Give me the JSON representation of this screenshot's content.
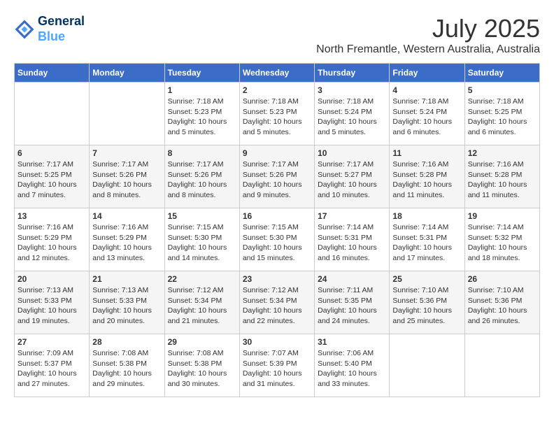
{
  "header": {
    "logo_line1": "General",
    "logo_line2": "Blue",
    "month": "July 2025",
    "location": "North Fremantle, Western Australia, Australia"
  },
  "weekdays": [
    "Sunday",
    "Monday",
    "Tuesday",
    "Wednesday",
    "Thursday",
    "Friday",
    "Saturday"
  ],
  "weeks": [
    [
      {
        "day": "",
        "info": ""
      },
      {
        "day": "",
        "info": ""
      },
      {
        "day": "1",
        "info": "Sunrise: 7:18 AM\nSunset: 5:23 PM\nDaylight: 10 hours\nand 5 minutes."
      },
      {
        "day": "2",
        "info": "Sunrise: 7:18 AM\nSunset: 5:23 PM\nDaylight: 10 hours\nand 5 minutes."
      },
      {
        "day": "3",
        "info": "Sunrise: 7:18 AM\nSunset: 5:24 PM\nDaylight: 10 hours\nand 5 minutes."
      },
      {
        "day": "4",
        "info": "Sunrise: 7:18 AM\nSunset: 5:24 PM\nDaylight: 10 hours\nand 6 minutes."
      },
      {
        "day": "5",
        "info": "Sunrise: 7:18 AM\nSunset: 5:25 PM\nDaylight: 10 hours\nand 6 minutes."
      }
    ],
    [
      {
        "day": "6",
        "info": "Sunrise: 7:17 AM\nSunset: 5:25 PM\nDaylight: 10 hours\nand 7 minutes."
      },
      {
        "day": "7",
        "info": "Sunrise: 7:17 AM\nSunset: 5:26 PM\nDaylight: 10 hours\nand 8 minutes."
      },
      {
        "day": "8",
        "info": "Sunrise: 7:17 AM\nSunset: 5:26 PM\nDaylight: 10 hours\nand 8 minutes."
      },
      {
        "day": "9",
        "info": "Sunrise: 7:17 AM\nSunset: 5:26 PM\nDaylight: 10 hours\nand 9 minutes."
      },
      {
        "day": "10",
        "info": "Sunrise: 7:17 AM\nSunset: 5:27 PM\nDaylight: 10 hours\nand 10 minutes."
      },
      {
        "day": "11",
        "info": "Sunrise: 7:16 AM\nSunset: 5:28 PM\nDaylight: 10 hours\nand 11 minutes."
      },
      {
        "day": "12",
        "info": "Sunrise: 7:16 AM\nSunset: 5:28 PM\nDaylight: 10 hours\nand 11 minutes."
      }
    ],
    [
      {
        "day": "13",
        "info": "Sunrise: 7:16 AM\nSunset: 5:29 PM\nDaylight: 10 hours\nand 12 minutes."
      },
      {
        "day": "14",
        "info": "Sunrise: 7:16 AM\nSunset: 5:29 PM\nDaylight: 10 hours\nand 13 minutes."
      },
      {
        "day": "15",
        "info": "Sunrise: 7:15 AM\nSunset: 5:30 PM\nDaylight: 10 hours\nand 14 minutes."
      },
      {
        "day": "16",
        "info": "Sunrise: 7:15 AM\nSunset: 5:30 PM\nDaylight: 10 hours\nand 15 minutes."
      },
      {
        "day": "17",
        "info": "Sunrise: 7:14 AM\nSunset: 5:31 PM\nDaylight: 10 hours\nand 16 minutes."
      },
      {
        "day": "18",
        "info": "Sunrise: 7:14 AM\nSunset: 5:31 PM\nDaylight: 10 hours\nand 17 minutes."
      },
      {
        "day": "19",
        "info": "Sunrise: 7:14 AM\nSunset: 5:32 PM\nDaylight: 10 hours\nand 18 minutes."
      }
    ],
    [
      {
        "day": "20",
        "info": "Sunrise: 7:13 AM\nSunset: 5:33 PM\nDaylight: 10 hours\nand 19 minutes."
      },
      {
        "day": "21",
        "info": "Sunrise: 7:13 AM\nSunset: 5:33 PM\nDaylight: 10 hours\nand 20 minutes."
      },
      {
        "day": "22",
        "info": "Sunrise: 7:12 AM\nSunset: 5:34 PM\nDaylight: 10 hours\nand 21 minutes."
      },
      {
        "day": "23",
        "info": "Sunrise: 7:12 AM\nSunset: 5:34 PM\nDaylight: 10 hours\nand 22 minutes."
      },
      {
        "day": "24",
        "info": "Sunrise: 7:11 AM\nSunset: 5:35 PM\nDaylight: 10 hours\nand 24 minutes."
      },
      {
        "day": "25",
        "info": "Sunrise: 7:10 AM\nSunset: 5:36 PM\nDaylight: 10 hours\nand 25 minutes."
      },
      {
        "day": "26",
        "info": "Sunrise: 7:10 AM\nSunset: 5:36 PM\nDaylight: 10 hours\nand 26 minutes."
      }
    ],
    [
      {
        "day": "27",
        "info": "Sunrise: 7:09 AM\nSunset: 5:37 PM\nDaylight: 10 hours\nand 27 minutes."
      },
      {
        "day": "28",
        "info": "Sunrise: 7:08 AM\nSunset: 5:38 PM\nDaylight: 10 hours\nand 29 minutes."
      },
      {
        "day": "29",
        "info": "Sunrise: 7:08 AM\nSunset: 5:38 PM\nDaylight: 10 hours\nand 30 minutes."
      },
      {
        "day": "30",
        "info": "Sunrise: 7:07 AM\nSunset: 5:39 PM\nDaylight: 10 hours\nand 31 minutes."
      },
      {
        "day": "31",
        "info": "Sunrise: 7:06 AM\nSunset: 5:40 PM\nDaylight: 10 hours\nand 33 minutes."
      },
      {
        "day": "",
        "info": ""
      },
      {
        "day": "",
        "info": ""
      }
    ]
  ]
}
